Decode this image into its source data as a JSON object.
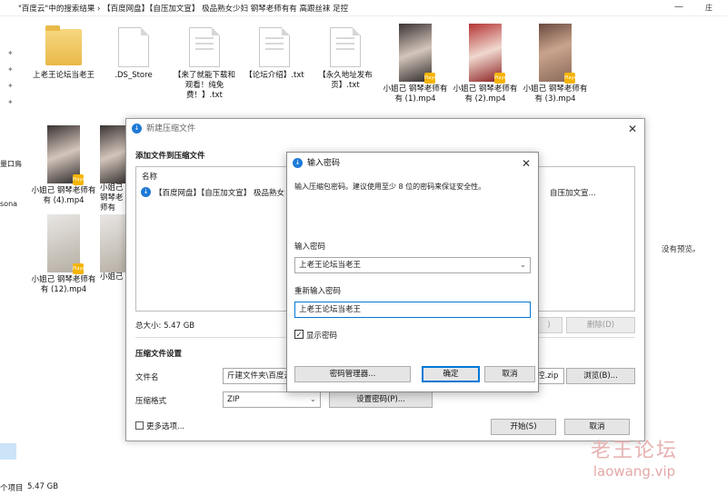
{
  "explorer": {
    "title": "\"百度云\"中的搜索结果 › 【百度网盘】【自压加文宣】 极品熟女少妇 钢琴老师有有 高跟丝袜 足控",
    "nav_items": [
      "量口鳥",
      "sona"
    ],
    "right_tab": "庄",
    "preview_text": "没有预览。",
    "status_count": "个项目",
    "status_size": "5.47 GB",
    "files_row1": [
      {
        "name": "上老王论坛当老王",
        "type": "folder"
      },
      {
        "name": ".DS_Store",
        "type": "doc"
      },
      {
        "name": "【来了就能下载和观看！纯免费！】.txt",
        "type": "doc"
      },
      {
        "name": "【论坛介绍】.txt",
        "type": "doc"
      },
      {
        "name": "【永久地址发布页】.txt",
        "type": "doc"
      },
      {
        "name": "小姐己 钢琴老师有有 (1).mp4",
        "type": "video"
      },
      {
        "name": "小姐己 钢琴老师有有 (2).mp4",
        "type": "video"
      },
      {
        "name": "小姐己 钢琴老师有有 (3).mp4",
        "type": "video"
      }
    ],
    "files_left": [
      {
        "name": "小姐己 钢琴老师有有 (4).mp4"
      },
      {
        "name": "小姐己 钢琴老师有"
      },
      {
        "name": "小姐己 钢琴老师有有 (12).mp4"
      },
      {
        "name": "小姐己 钢琴老师有有 ("
      }
    ],
    "badge_label": "Player"
  },
  "archive_dialog": {
    "title": "新建压缩文件",
    "section_add": "添加文件到压缩文件",
    "list_header": "名称",
    "list_item": "【百度网盘】【自压加文宣】 极品熟女",
    "list_item_tail": "自压加文宣...",
    "total_size": "总大小: 5.47 GB",
    "btn_add_tail": ")",
    "btn_delete": "删除(D)",
    "section_settings": "压缩文件设置",
    "label_filename": "文件名",
    "filename_value": "斤建文件夹\\百度云",
    "filename_tail": "控.zip",
    "btn_browse": "浏览(B)...",
    "label_format": "压缩格式",
    "format_value": "ZIP",
    "btn_set_password": "设置密码(P)...",
    "more_options": "更多选项...",
    "btn_start": "开始(S)",
    "btn_cancel": "取消"
  },
  "password_dialog": {
    "title": "输入密码",
    "hint": "输入压缩包密码。建议使用至少 8 位的密码来保证安全性。",
    "label_enter": "输入密码",
    "password_value": "上老王论坛当老王",
    "label_reenter": "重新输入密码",
    "reenter_value": "上老王论坛当老王",
    "show_password": "显示密码",
    "btn_manager": "密码管理器...",
    "btn_ok": "确定",
    "btn_cancel": "取消"
  },
  "watermark": {
    "line1": "老王论坛",
    "line2": "laowang.vip"
  }
}
